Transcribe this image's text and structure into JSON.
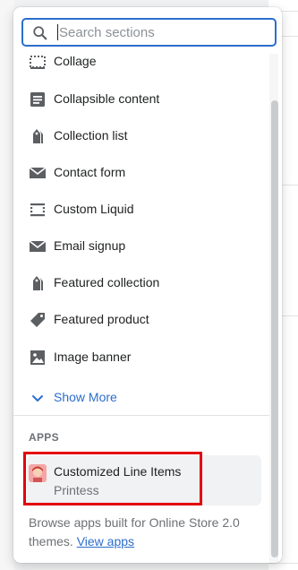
{
  "search": {
    "placeholder": "Search sections",
    "value": ""
  },
  "sections": {
    "partial_item": "Collage",
    "items": [
      {
        "label": "Collapsible content",
        "icon": "collapsible-icon"
      },
      {
        "label": "Collection list",
        "icon": "tag-multiple-icon"
      },
      {
        "label": "Contact form",
        "icon": "envelope-icon"
      },
      {
        "label": "Custom Liquid",
        "icon": "dashed-box-icon"
      },
      {
        "label": "Email signup",
        "icon": "envelope-icon"
      },
      {
        "label": "Featured collection",
        "icon": "tag-multiple-icon"
      },
      {
        "label": "Featured product",
        "icon": "tag-icon"
      },
      {
        "label": "Image banner",
        "icon": "image-icon"
      }
    ],
    "show_more": "Show More"
  },
  "apps": {
    "heading": "APPS",
    "items": [
      {
        "name": "Customized Line Items",
        "vendor": "Printess"
      }
    ],
    "browse_text": "Browse apps built for Online Store 2.0 themes.",
    "browse_link": "View apps"
  },
  "colors": {
    "accent": "#2c6ecb",
    "highlight_border": "#e3000f",
    "icon": "#5c5f62"
  }
}
